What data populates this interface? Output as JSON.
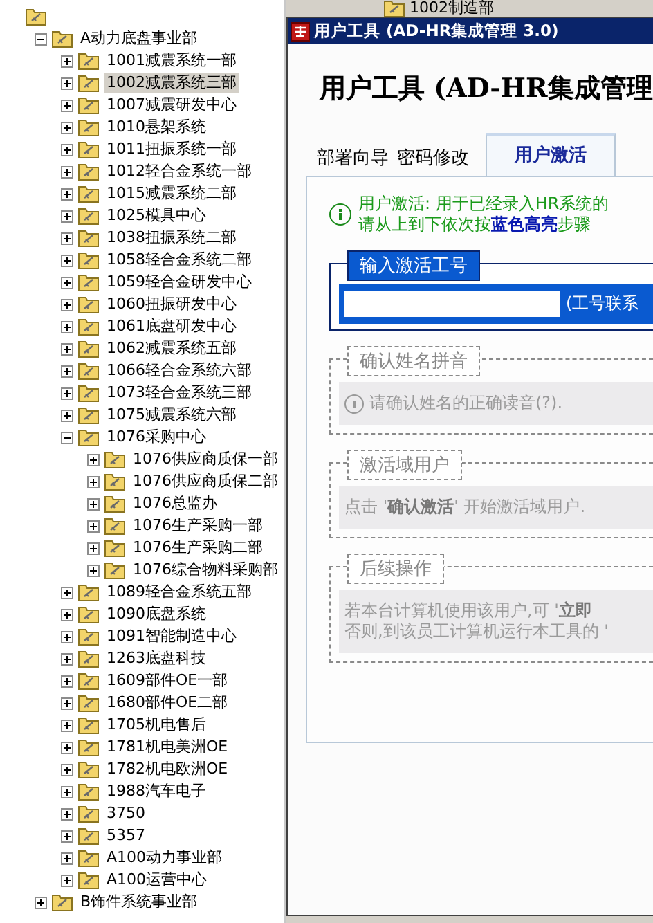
{
  "tree": {
    "children": [
      {
        "label": "A动力底盘事业部",
        "expanded": true,
        "selected": false,
        "children": [
          {
            "label": "1001减震系统一部",
            "expanded": false,
            "selected": false
          },
          {
            "label": "1002减震系统三部",
            "expanded": false,
            "selected": true
          },
          {
            "label": "1007减震研发中心",
            "expanded": false,
            "selected": false
          },
          {
            "label": "1010悬架系统",
            "expanded": false,
            "selected": false
          },
          {
            "label": "1011扭振系统一部",
            "expanded": false,
            "selected": false
          },
          {
            "label": "1012轻合金系统一部",
            "expanded": false,
            "selected": false
          },
          {
            "label": "1015减震系统二部",
            "expanded": false,
            "selected": false
          },
          {
            "label": "1025模具中心",
            "expanded": false,
            "selected": false
          },
          {
            "label": "1038扭振系统二部",
            "expanded": false,
            "selected": false
          },
          {
            "label": "1058轻合金系统二部",
            "expanded": false,
            "selected": false
          },
          {
            "label": "1059轻合金研发中心",
            "expanded": false,
            "selected": false
          },
          {
            "label": "1060扭振研发中心",
            "expanded": false,
            "selected": false
          },
          {
            "label": "1061底盘研发中心",
            "expanded": false,
            "selected": false
          },
          {
            "label": "1062减震系统五部",
            "expanded": false,
            "selected": false
          },
          {
            "label": "1066轻合金系统六部",
            "expanded": false,
            "selected": false
          },
          {
            "label": "1073轻合金系统三部",
            "expanded": false,
            "selected": false
          },
          {
            "label": "1075减震系统六部",
            "expanded": false,
            "selected": false
          },
          {
            "label": "1076采购中心",
            "expanded": true,
            "selected": false,
            "children": [
              {
                "label": "1076供应商质保一部",
                "expanded": false,
                "selected": false
              },
              {
                "label": "1076供应商质保二部",
                "expanded": false,
                "selected": false
              },
              {
                "label": "1076总监办",
                "expanded": false,
                "selected": false
              },
              {
                "label": "1076生产采购一部",
                "expanded": false,
                "selected": false
              },
              {
                "label": "1076生产采购二部",
                "expanded": false,
                "selected": false
              },
              {
                "label": "1076综合物料采购部",
                "expanded": false,
                "selected": false
              }
            ]
          },
          {
            "label": "1089轻合金系统五部",
            "expanded": false,
            "selected": false
          },
          {
            "label": "1090底盘系统",
            "expanded": false,
            "selected": false
          },
          {
            "label": "1091智能制造中心",
            "expanded": false,
            "selected": false
          },
          {
            "label": "1263底盘科技",
            "expanded": false,
            "selected": false
          },
          {
            "label": "1609部件OE一部",
            "expanded": false,
            "selected": false
          },
          {
            "label": "1680部件OE二部",
            "expanded": false,
            "selected": false
          },
          {
            "label": "1705机电售后",
            "expanded": false,
            "selected": false
          },
          {
            "label": "1781机电美洲OE",
            "expanded": false,
            "selected": false
          },
          {
            "label": "1782机电欧洲OE",
            "expanded": false,
            "selected": false
          },
          {
            "label": "1988汽车电子",
            "expanded": false,
            "selected": false
          },
          {
            "label": "3750",
            "expanded": false,
            "selected": false
          },
          {
            "label": "5357",
            "expanded": false,
            "selected": false
          },
          {
            "label": "A100动力事业部",
            "expanded": false,
            "selected": false
          },
          {
            "label": "A100运营中心",
            "expanded": false,
            "selected": false
          }
        ]
      },
      {
        "label": "B饰件系统事业部",
        "expanded": false,
        "selected": false
      }
    ]
  },
  "background_window": {
    "item": "1002制造部"
  },
  "window": {
    "title": "用户工具 (AD-HR集成管理 3.0)",
    "heading": "用户工具 (AD-HR集成管理",
    "tabs": [
      {
        "label": "部署向导",
        "selected": false
      },
      {
        "label": "密码修改",
        "selected": false
      },
      {
        "label": "用户激活",
        "selected": true
      }
    ],
    "info": [
      "用户激活: 用于已经录入HR系统的",
      "请从上到下依次按**蓝色高亮**步骤"
    ],
    "steps": [
      {
        "kind": "input",
        "title": "输入激活工号",
        "hint": "(工号联系"
      },
      {
        "kind": "note",
        "title": "确认姓名拼音",
        "info_icon": true,
        "lines": [
          "请确认姓名的正确读音(?)."
        ]
      },
      {
        "kind": "note",
        "title": "激活域用户",
        "info_icon": false,
        "lines": [
          "点击 '**确认激活**' 开始激活域用户."
        ]
      },
      {
        "kind": "note",
        "title": "后续操作",
        "info_icon": false,
        "lines": [
          "若本台计算机使用该用户,可 '**立即**",
          "否则,到该员工计算机运行本工具的 '"
        ]
      }
    ]
  }
}
